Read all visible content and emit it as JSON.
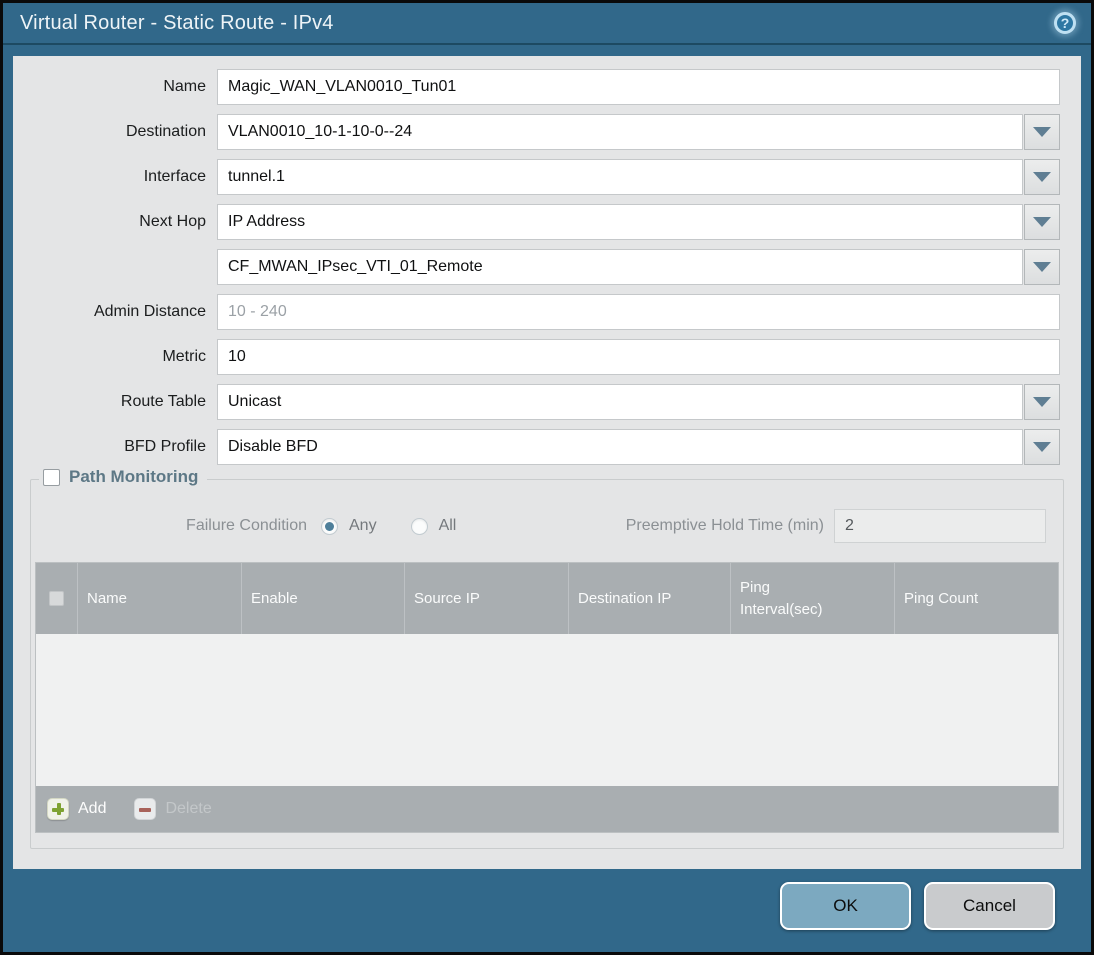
{
  "window": {
    "title": "Virtual Router - Static Route - IPv4"
  },
  "icons": {
    "help": "?"
  },
  "form": {
    "rows": [
      {
        "label": "Name",
        "value": "Magic_WAN_VLAN0010_Tun01"
      },
      {
        "label": "Destination",
        "value": "VLAN0010_10-1-10-0--24"
      },
      {
        "label": "Interface",
        "value": "tunnel.1"
      },
      {
        "label": "Next Hop",
        "value": "IP Address"
      },
      {
        "label": "",
        "value": "CF_MWAN_IPsec_VTI_01_Remote"
      },
      {
        "label": "Admin Distance",
        "placeholder": "10 - 240"
      },
      {
        "label": "Metric",
        "value": "10"
      },
      {
        "label": "Route Table",
        "value": "Unicast"
      },
      {
        "label": "BFD Profile",
        "value": "Disable BFD"
      }
    ]
  },
  "path_monitoring": {
    "legend": "Path Monitoring",
    "checkbox_checked": false,
    "failure_condition_label": "Failure Condition",
    "options": {
      "any": "Any",
      "all": "All",
      "selected": "Any"
    },
    "preemptive_label": "Preemptive Hold Time (min)",
    "preemptive_value": "2",
    "table": {
      "columns": [
        "Name",
        "Enable",
        "Source IP",
        "Destination IP",
        "Ping Interval(sec)",
        "Ping Count"
      ],
      "rows": []
    },
    "toolbar": {
      "add_label": "Add",
      "delete_label": "Delete"
    }
  },
  "footer": {
    "ok_label": "OK",
    "cancel_label": "Cancel"
  },
  "colors": {
    "titlebar": "#31688a",
    "body": "#e4e5e6",
    "table_header": "#a9aeb1",
    "ok_button": "#7ca9c0",
    "cancel_button": "#c9cbcd",
    "add_icon_green": "#7ea232",
    "delete_icon_red": "#a8625a",
    "dropdown_arrow": "#5f7e93"
  }
}
